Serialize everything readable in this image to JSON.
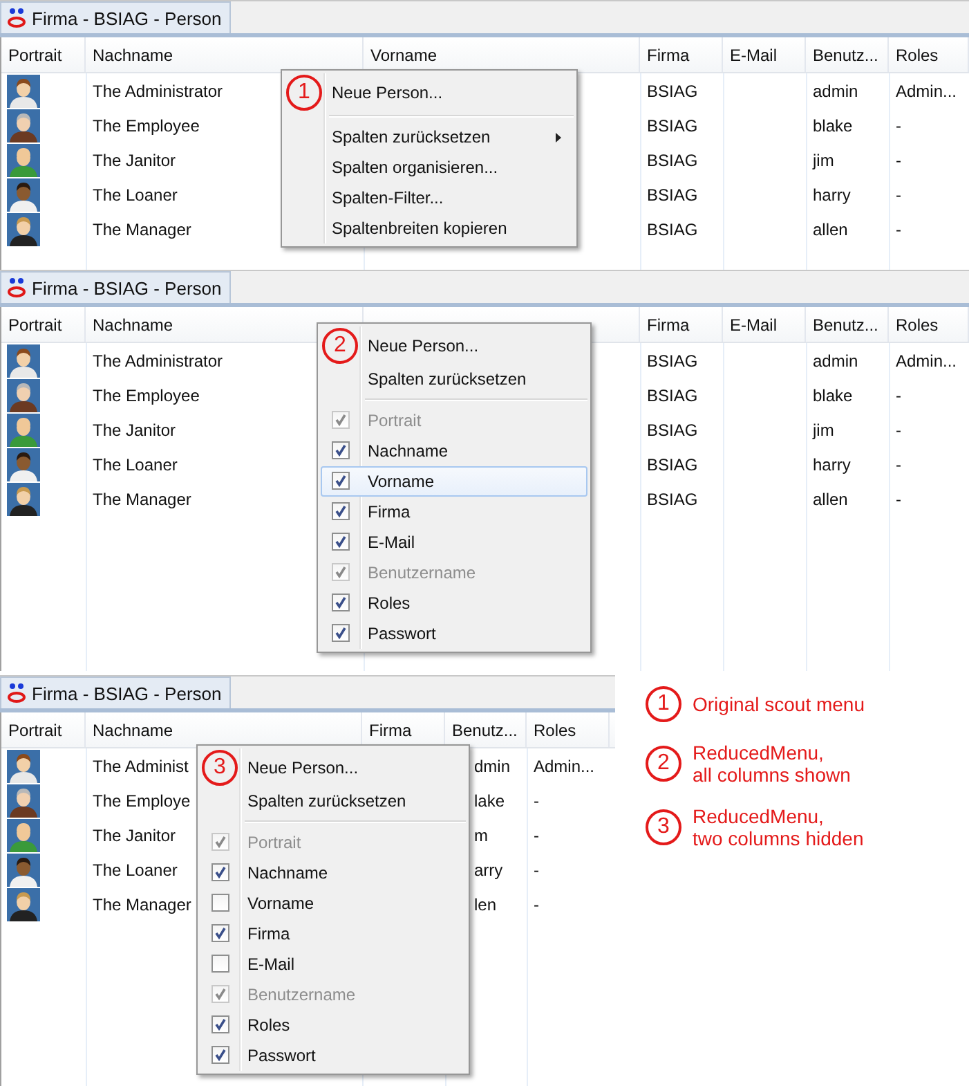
{
  "panels": [
    {
      "tab": {
        "title": "Firma - BSIAG - Person"
      },
      "columns": [
        "Portrait",
        "Nachname",
        "Vorname",
        "Firma",
        "E-Mail",
        "Benutz...",
        "Roles"
      ],
      "rows": [
        {
          "cells": [
            null,
            "The Administrator",
            null,
            "BSIAG",
            null,
            "admin",
            "Admin..."
          ]
        },
        {
          "cells": [
            null,
            "The Employee",
            null,
            "BSIAG",
            null,
            "blake",
            "-"
          ]
        },
        {
          "cells": [
            null,
            "The Janitor",
            null,
            "BSIAG",
            null,
            "jim",
            "-"
          ]
        },
        {
          "cells": [
            null,
            "The Loaner",
            null,
            "BSIAG",
            null,
            "harry",
            "-"
          ]
        },
        {
          "cells": [
            null,
            "The Manager",
            null,
            "BSIAG",
            null,
            "allen",
            "-"
          ]
        }
      ],
      "menu": {
        "marker": "1",
        "items": [
          {
            "kind": "action",
            "label": "Neue Person..."
          },
          {
            "kind": "separator"
          },
          {
            "kind": "submenu",
            "label": "Spalten zurücksetzen"
          },
          {
            "kind": "action",
            "label": "Spalten organisieren..."
          },
          {
            "kind": "action",
            "label": "Spalten-Filter..."
          },
          {
            "kind": "action",
            "label": "Spaltenbreiten kopieren"
          }
        ]
      }
    },
    {
      "tab": {
        "title": "Firma - BSIAG - Person"
      },
      "columns": [
        "Portrait",
        "Nachname",
        null,
        "Firma",
        "E-Mail",
        "Benutz...",
        "Roles"
      ],
      "rows": [
        {
          "cells": [
            null,
            "The Administrator",
            null,
            "BSIAG",
            null,
            "admin",
            "Admin..."
          ]
        },
        {
          "cells": [
            null,
            "The Employee",
            null,
            "BSIAG",
            null,
            "blake",
            "-"
          ]
        },
        {
          "cells": [
            null,
            "The Janitor",
            null,
            "BSIAG",
            null,
            "jim",
            "-"
          ]
        },
        {
          "cells": [
            null,
            "The Loaner",
            null,
            "BSIAG",
            null,
            "harry",
            "-"
          ]
        },
        {
          "cells": [
            null,
            "The Manager",
            null,
            "BSIAG",
            null,
            "allen",
            "-"
          ]
        }
      ],
      "menu": {
        "marker": "2",
        "items": [
          {
            "kind": "action",
            "label": "Neue Person..."
          },
          {
            "kind": "action",
            "label": "Spalten zurücksetzen"
          },
          {
            "kind": "separator"
          },
          {
            "kind": "check",
            "label": "Portrait",
            "checked": true,
            "disabled": true,
            "highlighted": false
          },
          {
            "kind": "check",
            "label": "Nachname",
            "checked": true,
            "disabled": false,
            "highlighted": false
          },
          {
            "kind": "check",
            "label": "Vorname",
            "checked": true,
            "disabled": false,
            "highlighted": true
          },
          {
            "kind": "check",
            "label": "Firma",
            "checked": true,
            "disabled": false,
            "highlighted": false
          },
          {
            "kind": "check",
            "label": "E-Mail",
            "checked": true,
            "disabled": false,
            "highlighted": false
          },
          {
            "kind": "check",
            "label": "Benutzername",
            "checked": true,
            "disabled": true,
            "highlighted": false
          },
          {
            "kind": "check",
            "label": "Roles",
            "checked": true,
            "disabled": false,
            "highlighted": false
          },
          {
            "kind": "check",
            "label": "Passwort",
            "checked": true,
            "disabled": false,
            "highlighted": false
          }
        ]
      }
    },
    {
      "tab": {
        "title": "Firma - BSIAG - Person"
      },
      "columns": [
        "Portrait",
        "Nachname",
        "Firma",
        "Benutz...",
        "Roles"
      ],
      "rows": [
        {
          "cells": [
            null,
            "The Administ",
            null,
            "dmin",
            "Admin..."
          ]
        },
        {
          "cells": [
            null,
            "The Employe",
            null,
            "lake",
            "-"
          ]
        },
        {
          "cells": [
            null,
            "The Janitor",
            null,
            "m",
            "-"
          ]
        },
        {
          "cells": [
            null,
            "The Loaner",
            null,
            "arry",
            "-"
          ]
        },
        {
          "cells": [
            null,
            "The Manager",
            null,
            "len",
            "-"
          ]
        }
      ],
      "menu": {
        "marker": "3",
        "items": [
          {
            "kind": "action",
            "label": "Neue Person..."
          },
          {
            "kind": "action",
            "label": "Spalten zurücksetzen"
          },
          {
            "kind": "separator"
          },
          {
            "kind": "check",
            "label": "Portrait",
            "checked": true,
            "disabled": true,
            "highlighted": false
          },
          {
            "kind": "check",
            "label": "Nachname",
            "checked": true,
            "disabled": false,
            "highlighted": false
          },
          {
            "kind": "check",
            "label": "Vorname",
            "checked": false,
            "disabled": false,
            "highlighted": false
          },
          {
            "kind": "check",
            "label": "Firma",
            "checked": true,
            "disabled": false,
            "highlighted": false
          },
          {
            "kind": "check",
            "label": "E-Mail",
            "checked": false,
            "disabled": false,
            "highlighted": false
          },
          {
            "kind": "check",
            "label": "Benutzername",
            "checked": true,
            "disabled": true,
            "highlighted": false
          },
          {
            "kind": "check",
            "label": "Roles",
            "checked": true,
            "disabled": false,
            "highlighted": false
          },
          {
            "kind": "check",
            "label": "Passwort",
            "checked": true,
            "disabled": false,
            "highlighted": false
          }
        ]
      }
    }
  ],
  "legend": [
    {
      "number": "1",
      "lines": [
        "Original scout menu"
      ]
    },
    {
      "number": "2",
      "lines": [
        "ReducedMenu,",
        "all columns shown"
      ]
    },
    {
      "number": "3",
      "lines": [
        "ReducedMenu,",
        "two columns hidden"
      ]
    }
  ]
}
